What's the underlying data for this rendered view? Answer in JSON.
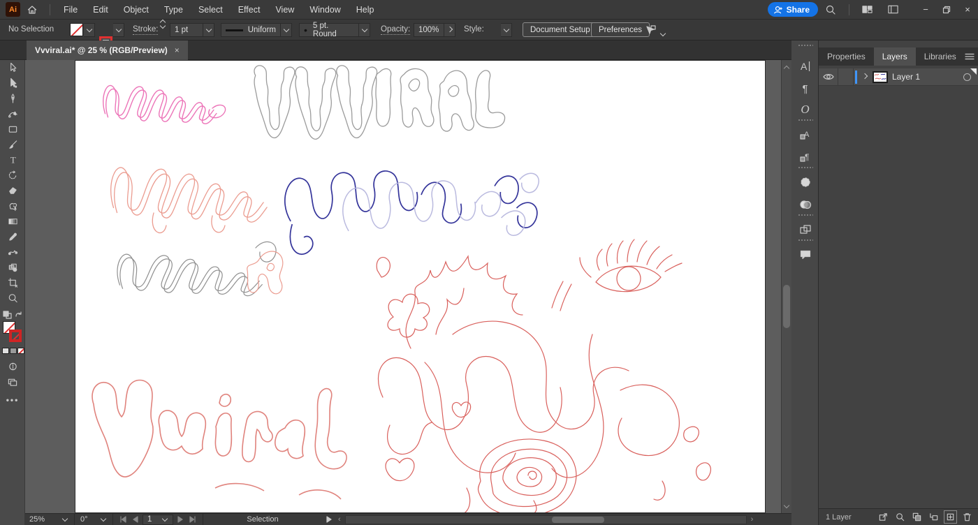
{
  "app": {
    "logo_text": "Ai"
  },
  "titlebar": {
    "menus": [
      "File",
      "Edit",
      "Object",
      "Type",
      "Select",
      "Effect",
      "View",
      "Window",
      "Help"
    ],
    "share_label": "Share",
    "icons": [
      "home-icon",
      "search-icon",
      "arrange-documents-icon",
      "workspace-switcher-icon",
      "minimize-icon",
      "restore-icon",
      "close-icon"
    ]
  },
  "control_bar": {
    "selection_status": "No Selection",
    "stroke_label": "Stroke:",
    "stroke_weight": "1 pt",
    "width_profile": "Uniform",
    "brush_name": "5 pt. Round",
    "opacity_label": "Opacity:",
    "opacity_value": "100%",
    "style_label": "Style:",
    "document_setup_label": "Document Setup",
    "preferences_label": "Preferences"
  },
  "document_tab": {
    "title": "Vvviral.ai* @ 25 % (RGB/Preview)",
    "close_glyph": "×"
  },
  "toolbar": {
    "tools": [
      "selection-tool",
      "direct-selection-tool",
      "pen-tool",
      "curvature-tool",
      "rectangle-tool",
      "paintbrush-tool",
      "type-tool",
      "rotate-tool",
      "eraser-tool",
      "shaper-tool",
      "gradient-tool",
      "eyedropper-tool",
      "blend-tool",
      "symbol-sprayer-tool",
      "artboard-tool",
      "zoom-tool"
    ]
  },
  "panels": {
    "tabs": [
      "Properties",
      "Layers",
      "Libraries"
    ],
    "layers": {
      "rows": [
        {
          "label": "Layer 1"
        }
      ],
      "footer_count": "1 Layer",
      "footer_icons": [
        "collect-for-export-icon",
        "locate-object-icon",
        "make-clipping-mask-icon",
        "create-sublayer-icon",
        "create-new-layer-icon",
        "delete-selection-icon"
      ]
    },
    "strip_icons": [
      "character-panel-icon",
      "paragraph-panel-icon",
      "opentype-panel-icon",
      "character-styles-panel-icon",
      "paragraph-styles-panel-icon",
      "brushes-panel-icon",
      "transparency-panel-icon",
      "artboards-panel-icon",
      "comments-panel-icon"
    ]
  },
  "status_bar": {
    "zoom_level": "25%",
    "rotation": "0°",
    "artboard_number": "1",
    "status_text": "Selection"
  },
  "colors": {
    "accent_blue": "#1473e6",
    "layer_selection_blue": "#4096fa",
    "artboard_white": "#ffffff"
  },
  "canvas": {
    "artworks": [
      {
        "name": "pink-script-vvviral",
        "color": "#ec74b8"
      },
      {
        "name": "gray-drippy-vvviral",
        "color": "#9b9b9b"
      },
      {
        "name": "salmon-script-vviral",
        "color": "#eb9c90"
      },
      {
        "name": "navy-bubble-vviral",
        "color": "#34349a"
      },
      {
        "name": "lavender-bubble-vviral",
        "color": "#babadf"
      },
      {
        "name": "gray-overlap-vviral",
        "color": "#8f8f8f"
      },
      {
        "name": "salmon-overlap-letter",
        "color": "#eb9c90"
      },
      {
        "name": "big-salmon-vviral",
        "color": "#e0837d"
      },
      {
        "name": "red-sketch-vvviral",
        "color": "#d9605c"
      }
    ]
  }
}
